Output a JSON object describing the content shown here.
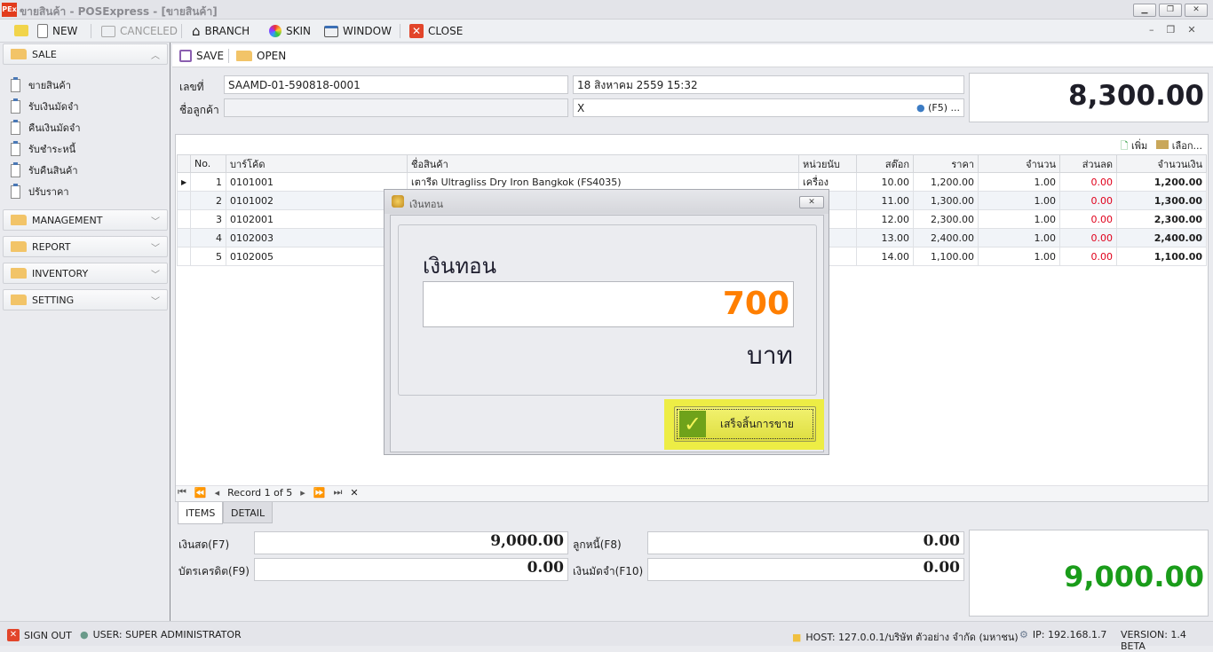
{
  "window": {
    "title": "ขายสินค้า - POSExpress - [ขายสินค้า]",
    "logo": "PEx"
  },
  "toolbar": {
    "new": "NEW",
    "canceled": "CANCELED",
    "branch": "BRANCH",
    "skin": "SKIN",
    "window": "WINDOW",
    "close": "CLOSE"
  },
  "sidebar": {
    "sale": "SALE",
    "items": [
      "ขายสินค้า",
      "รับเงินมัดจำ",
      "คืนเงินมัดจำ",
      "รับชำระหนี้",
      "รับคืนสินค้า",
      "ปรับราคา"
    ],
    "groups": [
      "MANAGEMENT",
      "REPORT",
      "INVENTORY",
      "SETTING"
    ]
  },
  "actions": {
    "save": "SAVE",
    "open": "OPEN"
  },
  "form": {
    "doc_label": "เลขที่",
    "doc_no": "SAAMD-01-590818-0001",
    "date": "18 สิงหาคม 2559 15:32",
    "customer_label": "ชื่อลูกค้า",
    "customer_name": "",
    "customer_code": "X",
    "customer_hint": "(F5) ...",
    "total": "8,300.00"
  },
  "grid": {
    "add": "เพิ่ม",
    "select": "เลือก...",
    "columns": [
      "No.",
      "บาร์โค้ด",
      "ชื่อสินค้า",
      "หน่วยนับ",
      "สต๊อก",
      "ราคา",
      "จำนวน",
      "ส่วนลด",
      "จำนวนเงิน"
    ],
    "rows": [
      [
        "1",
        "0101001",
        "เตารีด Ultragliss  Dry Iron Bangkok (FS4035)",
        "เครื่อง",
        "10.00",
        "1,200.00",
        "1.00",
        "0.00",
        "1,200.00"
      ],
      [
        "2",
        "0101002",
        "",
        "",
        "11.00",
        "1,300.00",
        "1.00",
        "0.00",
        "1,300.00"
      ],
      [
        "3",
        "0102001",
        "",
        "",
        "12.00",
        "2,300.00",
        "1.00",
        "0.00",
        "2,300.00"
      ],
      [
        "4",
        "0102003",
        "",
        "",
        "13.00",
        "2,400.00",
        "1.00",
        "0.00",
        "2,400.00"
      ],
      [
        "5",
        "0102005",
        "",
        "",
        "14.00",
        "1,100.00",
        "1.00",
        "0.00",
        "1,100.00"
      ]
    ],
    "record": "Record 1 of 5"
  },
  "tabs": {
    "items": "ITEMS",
    "detail": "DETAIL"
  },
  "payment": {
    "cash_label": "เงินสด(F7)",
    "cash": "9,000.00",
    "debtor_label": "ลูกหนี้(F8)",
    "debtor": "0.00",
    "card_label": "บัตรเครดิต(F9)",
    "card": "0.00",
    "deposit_label": "เงินมัดจำ(F10)",
    "deposit": "0.00",
    "paid_total": "9,000.00"
  },
  "dialog": {
    "title": "เงินทอน",
    "heading": "เงินทอน",
    "change": "700",
    "unit": "บาท",
    "finish": "เสร็จสิ้นการขาย"
  },
  "status": {
    "signout": "SIGN OUT",
    "user": "USER: SUPER ADMINISTRATOR",
    "host": "HOST: 127.0.0.1/บริษัท ตัวอย่าง จำกัด (มหาชน)",
    "ip": "IP: 192.168.1.7",
    "version": "VERSION: 1.4 BETA"
  },
  "colors": {
    "accent_orange": "#ff7f00",
    "green_total": "#1a9c1a",
    "highlight": "#eded45"
  }
}
